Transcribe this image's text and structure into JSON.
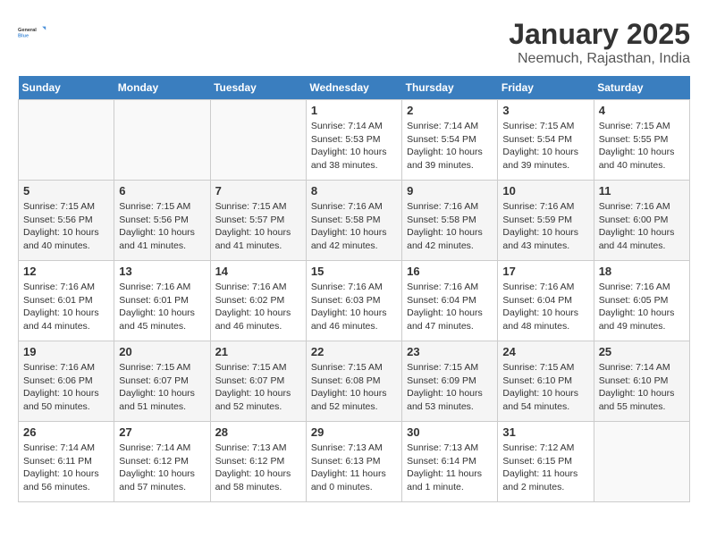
{
  "header": {
    "logo_line1": "General",
    "logo_line2": "Blue",
    "title": "January 2025",
    "subtitle": "Neemuch, Rajasthan, India"
  },
  "calendar": {
    "days_of_week": [
      "Sunday",
      "Monday",
      "Tuesday",
      "Wednesday",
      "Thursday",
      "Friday",
      "Saturday"
    ],
    "weeks": [
      [
        {
          "day": "",
          "info": ""
        },
        {
          "day": "",
          "info": ""
        },
        {
          "day": "",
          "info": ""
        },
        {
          "day": "1",
          "info": "Sunrise: 7:14 AM\nSunset: 5:53 PM\nDaylight: 10 hours\nand 38 minutes."
        },
        {
          "day": "2",
          "info": "Sunrise: 7:14 AM\nSunset: 5:54 PM\nDaylight: 10 hours\nand 39 minutes."
        },
        {
          "day": "3",
          "info": "Sunrise: 7:15 AM\nSunset: 5:54 PM\nDaylight: 10 hours\nand 39 minutes."
        },
        {
          "day": "4",
          "info": "Sunrise: 7:15 AM\nSunset: 5:55 PM\nDaylight: 10 hours\nand 40 minutes."
        }
      ],
      [
        {
          "day": "5",
          "info": "Sunrise: 7:15 AM\nSunset: 5:56 PM\nDaylight: 10 hours\nand 40 minutes."
        },
        {
          "day": "6",
          "info": "Sunrise: 7:15 AM\nSunset: 5:56 PM\nDaylight: 10 hours\nand 41 minutes."
        },
        {
          "day": "7",
          "info": "Sunrise: 7:15 AM\nSunset: 5:57 PM\nDaylight: 10 hours\nand 41 minutes."
        },
        {
          "day": "8",
          "info": "Sunrise: 7:16 AM\nSunset: 5:58 PM\nDaylight: 10 hours\nand 42 minutes."
        },
        {
          "day": "9",
          "info": "Sunrise: 7:16 AM\nSunset: 5:58 PM\nDaylight: 10 hours\nand 42 minutes."
        },
        {
          "day": "10",
          "info": "Sunrise: 7:16 AM\nSunset: 5:59 PM\nDaylight: 10 hours\nand 43 minutes."
        },
        {
          "day": "11",
          "info": "Sunrise: 7:16 AM\nSunset: 6:00 PM\nDaylight: 10 hours\nand 44 minutes."
        }
      ],
      [
        {
          "day": "12",
          "info": "Sunrise: 7:16 AM\nSunset: 6:01 PM\nDaylight: 10 hours\nand 44 minutes."
        },
        {
          "day": "13",
          "info": "Sunrise: 7:16 AM\nSunset: 6:01 PM\nDaylight: 10 hours\nand 45 minutes."
        },
        {
          "day": "14",
          "info": "Sunrise: 7:16 AM\nSunset: 6:02 PM\nDaylight: 10 hours\nand 46 minutes."
        },
        {
          "day": "15",
          "info": "Sunrise: 7:16 AM\nSunset: 6:03 PM\nDaylight: 10 hours\nand 46 minutes."
        },
        {
          "day": "16",
          "info": "Sunrise: 7:16 AM\nSunset: 6:04 PM\nDaylight: 10 hours\nand 47 minutes."
        },
        {
          "day": "17",
          "info": "Sunrise: 7:16 AM\nSunset: 6:04 PM\nDaylight: 10 hours\nand 48 minutes."
        },
        {
          "day": "18",
          "info": "Sunrise: 7:16 AM\nSunset: 6:05 PM\nDaylight: 10 hours\nand 49 minutes."
        }
      ],
      [
        {
          "day": "19",
          "info": "Sunrise: 7:16 AM\nSunset: 6:06 PM\nDaylight: 10 hours\nand 50 minutes."
        },
        {
          "day": "20",
          "info": "Sunrise: 7:15 AM\nSunset: 6:07 PM\nDaylight: 10 hours\nand 51 minutes."
        },
        {
          "day": "21",
          "info": "Sunrise: 7:15 AM\nSunset: 6:07 PM\nDaylight: 10 hours\nand 52 minutes."
        },
        {
          "day": "22",
          "info": "Sunrise: 7:15 AM\nSunset: 6:08 PM\nDaylight: 10 hours\nand 52 minutes."
        },
        {
          "day": "23",
          "info": "Sunrise: 7:15 AM\nSunset: 6:09 PM\nDaylight: 10 hours\nand 53 minutes."
        },
        {
          "day": "24",
          "info": "Sunrise: 7:15 AM\nSunset: 6:10 PM\nDaylight: 10 hours\nand 54 minutes."
        },
        {
          "day": "25",
          "info": "Sunrise: 7:14 AM\nSunset: 6:10 PM\nDaylight: 10 hours\nand 55 minutes."
        }
      ],
      [
        {
          "day": "26",
          "info": "Sunrise: 7:14 AM\nSunset: 6:11 PM\nDaylight: 10 hours\nand 56 minutes."
        },
        {
          "day": "27",
          "info": "Sunrise: 7:14 AM\nSunset: 6:12 PM\nDaylight: 10 hours\nand 57 minutes."
        },
        {
          "day": "28",
          "info": "Sunrise: 7:13 AM\nSunset: 6:12 PM\nDaylight: 10 hours\nand 58 minutes."
        },
        {
          "day": "29",
          "info": "Sunrise: 7:13 AM\nSunset: 6:13 PM\nDaylight: 11 hours\nand 0 minutes."
        },
        {
          "day": "30",
          "info": "Sunrise: 7:13 AM\nSunset: 6:14 PM\nDaylight: 11 hours\nand 1 minute."
        },
        {
          "day": "31",
          "info": "Sunrise: 7:12 AM\nSunset: 6:15 PM\nDaylight: 11 hours\nand 2 minutes."
        },
        {
          "day": "",
          "info": ""
        }
      ]
    ]
  }
}
